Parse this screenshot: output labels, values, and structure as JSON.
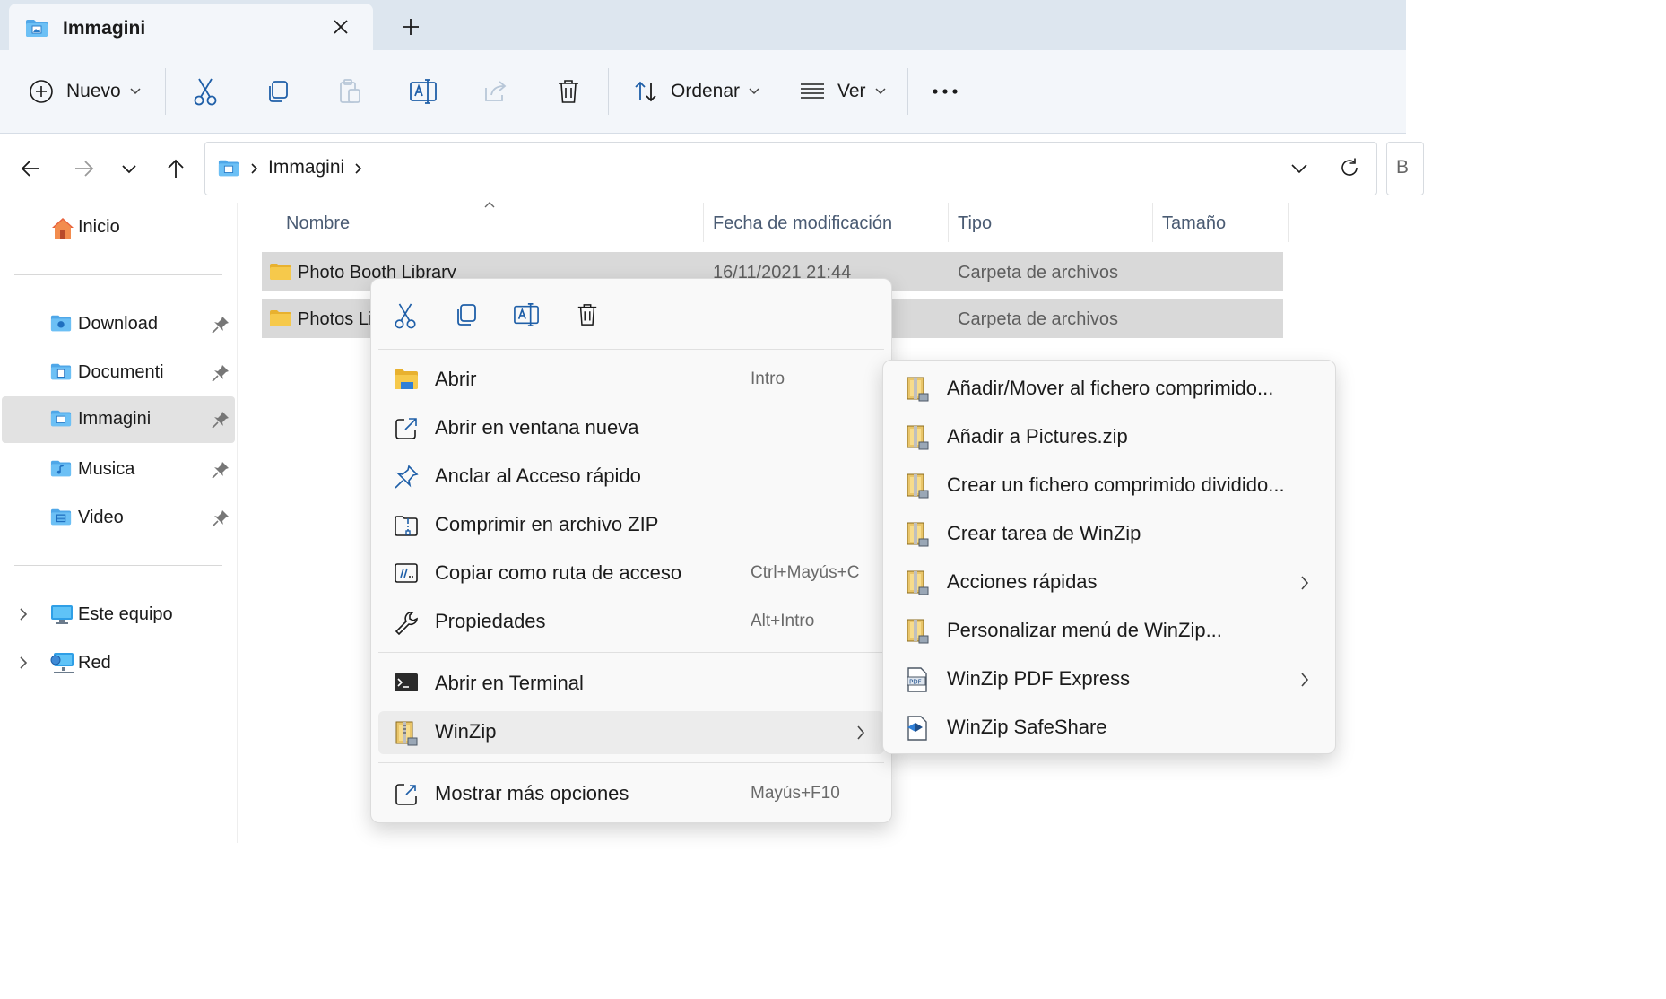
{
  "tab": {
    "title": "Immagini"
  },
  "toolbar": {
    "new_label": "Nuevo",
    "sort_label": "Ordenar",
    "view_label": "Ver"
  },
  "address": {
    "crumbs": [
      "Immagini"
    ],
    "search_placeholder_partial": "B"
  },
  "sidebar": {
    "home": "Inicio",
    "quick_access": [
      {
        "label": "Download",
        "icon": "download-folder-icon",
        "pinned": true
      },
      {
        "label": "Documenti",
        "icon": "documents-folder-icon",
        "pinned": true
      },
      {
        "label": "Immagini",
        "icon": "pictures-folder-icon",
        "pinned": true,
        "selected": true
      },
      {
        "label": "Musica",
        "icon": "music-folder-icon",
        "pinned": true
      },
      {
        "label": "Video",
        "icon": "video-folder-icon",
        "pinned": true
      }
    ],
    "this_pc": "Este equipo",
    "network": "Red"
  },
  "file_list": {
    "columns": [
      "Nombre",
      "Fecha de modificación",
      "Tipo",
      "Tamaño"
    ],
    "rows": [
      {
        "name": "Photo Booth Library",
        "date": "16/11/2021 21:44",
        "type": "Carpeta de archivos"
      },
      {
        "name": "Photos Li",
        "date": "",
        "type": "Carpeta de archivos"
      }
    ]
  },
  "context_menu": {
    "items": [
      {
        "label": "Abrir",
        "shortcut": "Intro",
        "icon": "folder-open-icon"
      },
      {
        "label": "Abrir en ventana nueva",
        "shortcut": "",
        "icon": "open-new-window-icon"
      },
      {
        "label": "Anclar al Acceso rápido",
        "shortcut": "",
        "icon": "pin-icon"
      },
      {
        "label": "Comprimir en archivo ZIP",
        "shortcut": "",
        "icon": "zip-icon"
      },
      {
        "label": "Copiar como ruta de acceso",
        "shortcut": "Ctrl+Mayús+C",
        "icon": "copy-path-icon"
      },
      {
        "label": "Propiedades",
        "shortcut": "Alt+Intro",
        "icon": "wrench-icon"
      },
      {
        "label": "Abrir en Terminal",
        "shortcut": "",
        "icon": "terminal-icon"
      },
      {
        "label": "WinZip",
        "shortcut": "",
        "icon": "winzip-icon"
      },
      {
        "label": "Mostrar más opciones",
        "shortcut": "Mayús+F10",
        "icon": "more-options-icon"
      }
    ]
  },
  "winzip_submenu": {
    "items": [
      {
        "label": "Añadir/Mover al fichero comprimido...",
        "has_submenu": false
      },
      {
        "label": "Añadir a Pictures.zip",
        "has_submenu": false
      },
      {
        "label": "Crear un fichero comprimido dividido...",
        "has_submenu": false
      },
      {
        "label": "Crear tarea de WinZip",
        "has_submenu": false
      },
      {
        "label": "Acciones rápidas",
        "has_submenu": true
      },
      {
        "label": "Personalizar menú de WinZip...",
        "has_submenu": false
      },
      {
        "label": "WinZip PDF Express",
        "has_submenu": true
      },
      {
        "label": "WinZip SafeShare",
        "has_submenu": false
      }
    ]
  },
  "colors": {
    "accent": "#0067c0",
    "folder": "#f6c94b",
    "selection": "#d9d9d9",
    "tabbar": "#dde6ef"
  }
}
